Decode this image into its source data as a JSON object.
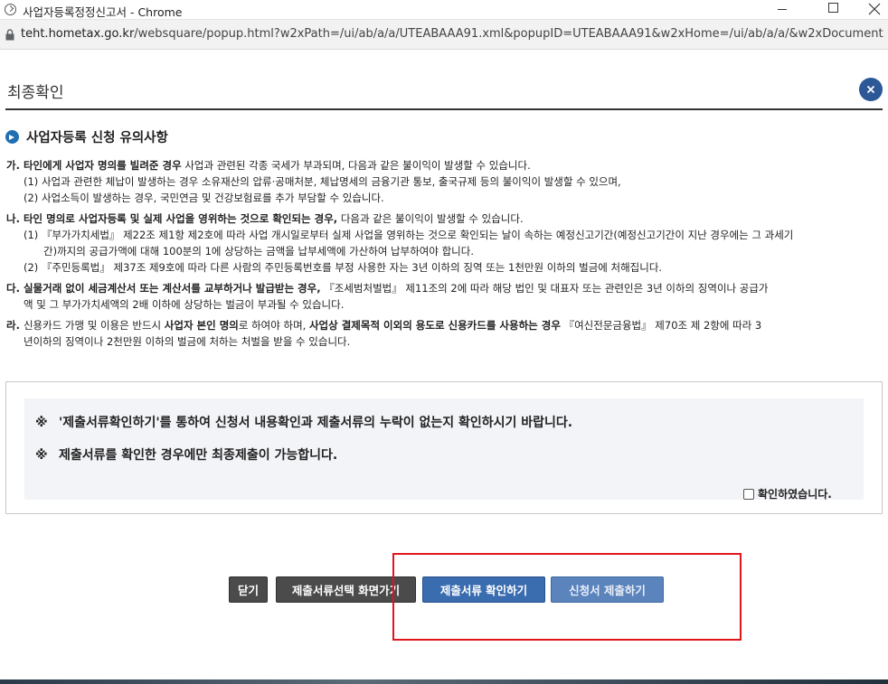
{
  "window": {
    "title": "사업자등록정정신고서 - Chrome",
    "url_host": "teht.hometax.go.kr",
    "url_path": "/websquare/popup.html?w2xPath=/ui/ab/a/a/UTEABAAA91.xml&popupID=UTEABAAA91&w2xHome=/ui/ab/a/a/&w2xDocument..."
  },
  "header": {
    "title": "최종확인"
  },
  "section": {
    "title": "사업자등록 신청 유의사항"
  },
  "notices": {
    "ga": {
      "prefix": "가. ",
      "bold": "타인에게 사업자 명의를 빌려준 경우",
      "text": " 사업과 관련된 각종 국세가 부과되며, 다음과 같은 불이익이 발생할 수 있습니다.",
      "item1": "(1) 사업과 관련한 체납이 발생하는 경우 소유재산의 압류·공매처분, 체납명세의 금융기관 통보, 출국규제 등의 불이익이 발생할 수 있으며,",
      "item2": "(2) 사업소득이 발생하는 경우, 국민연금 및 건강보험료를 추가 부담할 수 있습니다."
    },
    "na": {
      "prefix": "나. ",
      "bold": "타인 명의로 사업자등록 및 실제 사업을 영위하는 것으로 확인되는 경우,",
      "text": " 다음과 같은 불이익이 발생할 수 있습니다.",
      "item1_line1": "(1) 『부가가치세법』 제22조 제1항 제2호에 따라 사업 개시일로부터 실제 사업을 영위하는 것으로 확인되는 날이 속하는 예정신고기간(예정신고기간이 지난 경우에는 그 과세기",
      "item1_line2": "간)까지의 공급가액에 대해 100분의 1에 상당하는 금액을 납부세액에 가산하여 납부하여야 합니다.",
      "item2": "(2) 『주민등록법』 제37조 제9호에 따라 다른 사람의 주민등록번호를 부정 사용한 자는 3년 이하의 징역 또는 1천만원 이하의 벌금에 처해집니다."
    },
    "da": {
      "prefix": "다. ",
      "bold": "실물거래 없이 세금계산서 또는 계산서를 교부하거나 발급받는 경우,",
      "text": " 『조세범처벌법』 제11조의 2에 따라 해당 법인 및 대표자 또는 관련인은 3년 이하의 징역이나 공급가",
      "line2": "액 및 그 부가가치세액의 2배 이하에 상당하는 벌금이 부과될 수 있습니다."
    },
    "ra": {
      "prefix": "라. ",
      "text1": "신용카드 가맹 및 이용은 반드시 ",
      "bold1": "사업자 본인 명의",
      "text2": "로 하여야 하며, ",
      "bold2": "사업상 결제목적 이외의 용도로 신용카드를 사용하는 경우",
      "text3": " 『여신전문금융법』 제70조 제 2항에 따라 3",
      "line2": "년이하의 징역이나 2천만원 이하의 벌금에 처하는 처벌을 받을 수 있습니다."
    }
  },
  "confirm": {
    "mark": "※",
    "line1": "'제출서류확인하기'를 통하여 신청서 내용확인과 제출서류의 누락이 없는지 확인하시기 바랍니다.",
    "line2": "제출서류를 확인한 경우에만 최종제출이 가능합니다.",
    "checkbox_label": "확인하였습니다."
  },
  "buttons": {
    "close": "닫기",
    "select": "제출서류선택 화면가기",
    "check": "제출서류 확인하기",
    "submit": "신청서 제출하기"
  },
  "colors": {
    "accent": "#2c5897",
    "highlight_frame": "#e0161b",
    "button_blue": "#3a6cb0",
    "button_dark": "#4b4b4b"
  }
}
